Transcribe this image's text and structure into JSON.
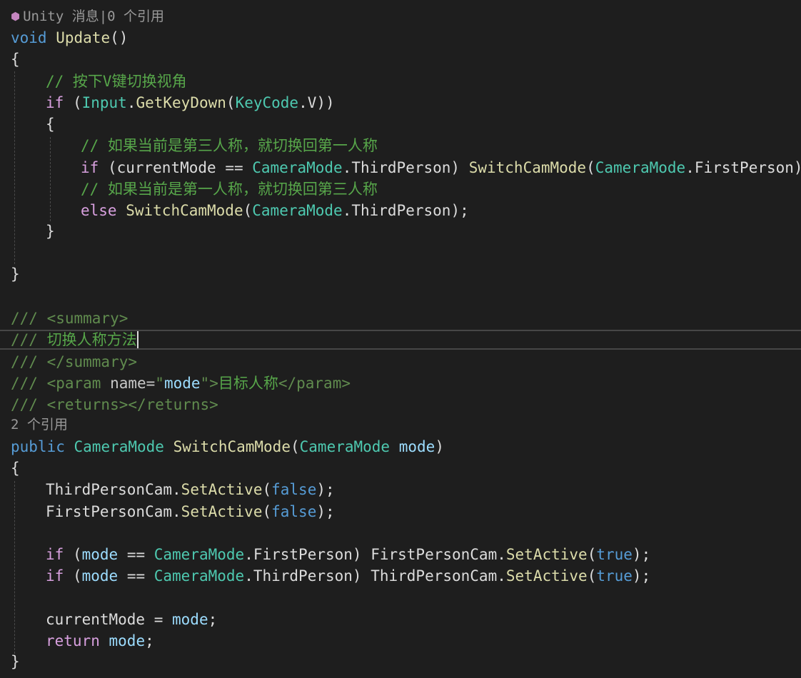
{
  "editor": {
    "codelens_unity": "Unity 消息|0 个引用",
    "codelens_refs": "2 个引用",
    "keywords": {
      "void": "void",
      "if": "if",
      "else": "else",
      "public": "public",
      "return": "return",
      "false": "false",
      "true": "true"
    },
    "punct": {
      "open_brace": "{",
      "close_brace": "}",
      "parens": "()",
      "open_paren": "(",
      "close_paren": ")",
      "close_paren_sp": ") ",
      "close_2paren": "))",
      "close_stmt": ");",
      "semicolon": ";",
      "dot": ".",
      "sp": " ",
      "sp_paren": " (",
      "eq": " == ",
      "assign": " = "
    },
    "names": {
      "update": "Update",
      "input": "Input",
      "get_key_down": "GetKeyDown",
      "key_code": "KeyCode",
      "v": "V",
      "current_mode": "currentMode",
      "camera_mode": "CameraMode",
      "third_person": "ThirdPerson",
      "first_person": "FirstPerson",
      "switch_cam_mode": "SwitchCamMode",
      "mode": "mode",
      "third_person_cam": "ThirdPersonCam",
      "first_person_cam": "FirstPersonCam",
      "set_active": "SetActive"
    },
    "comments": {
      "press_v": "// 按下V键切换视角",
      "if_third": "// 如果当前是第三人称，就切换回第一人称",
      "if_first": "// 如果当前是第一人称，就切换回第三人称"
    },
    "xml_doc": {
      "slashes": "/// ",
      "summary_open": "<summary>",
      "summary_text": "切换人称方法",
      "summary_close": "</summary>",
      "param_open": "<param",
      "name_attr": " name=",
      "quote": "\"",
      "mode_value": "mode",
      "gt": ">",
      "param_text": "目标人称",
      "param_close": "</param>",
      "returns": "<returns></returns>"
    }
  }
}
